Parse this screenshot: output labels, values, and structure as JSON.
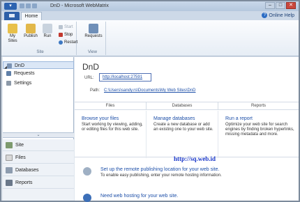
{
  "window": {
    "title": "DnD - Microsoft WebMatrix"
  },
  "ribbon": {
    "tab_home": "Home",
    "help": "Online Help",
    "site_group": {
      "label": "Site",
      "my_sites": "My Sites",
      "publish": "Publish",
      "run": "Run",
      "start": "Start",
      "stop": "Stop",
      "restart": "Restart"
    },
    "view_group": {
      "label": "View",
      "requests": "Requests"
    }
  },
  "tree": {
    "items": [
      {
        "label": "DnD"
      },
      {
        "label": "Requests"
      },
      {
        "label": "Settings"
      }
    ]
  },
  "workspaces": [
    {
      "label": "Site"
    },
    {
      "label": "Files"
    },
    {
      "label": "Databases"
    },
    {
      "label": "Reports"
    }
  ],
  "main": {
    "site_name": "DnD",
    "url_label": "URL:",
    "url": "http://localhost:27591",
    "path_label": "Path:",
    "path": "C:\\Users\\sandy.rs\\Documents\\My Web Sites\\DnD",
    "columns": [
      {
        "header": "Files",
        "title": "Browse your files",
        "desc": "Start working by viewing, adding, or editing files for this web site."
      },
      {
        "header": "Databases",
        "title": "Manage databases",
        "desc": "Create a new database or add an existing one to your web site."
      },
      {
        "header": "Reports",
        "title": "Run a report",
        "desc": "Optimize your web site for search engines by finding broken hyperlinks, missing metadata and more."
      }
    ],
    "watermark": "http://sq.web.id",
    "tasks": [
      {
        "title": "Set up the remote publishing location for your web site.",
        "desc": "To enable easy publishing, enter your remote hosting information."
      },
      {
        "title": "Need web hosting for your web site.",
        "desc": ""
      }
    ]
  }
}
